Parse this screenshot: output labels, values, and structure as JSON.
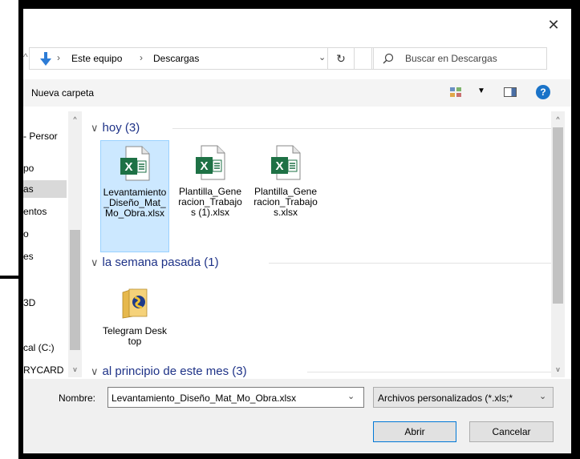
{
  "dialog": {
    "close_glyph": "✕",
    "nav_up_glyph": "^"
  },
  "address": {
    "sep1": "›",
    "crumb1": "Este equipo",
    "sep2": "›",
    "crumb2": "Descargas",
    "dropdown_glyph": "⌄",
    "refresh_glyph": "↻"
  },
  "search": {
    "placeholder": "Buscar en Descargas"
  },
  "commandbar": {
    "new_folder": "Nueva carpeta",
    "view_drop_glyph": "▼",
    "help_glyph": "?"
  },
  "nav_pane": {
    "items": [
      {
        "label": "- Persor"
      },
      {
        "label": "po"
      },
      {
        "label": "as"
      },
      {
        "label": "entos"
      },
      {
        "label": "o"
      },
      {
        "label": "es"
      },
      {
        "label": "3D"
      },
      {
        "label": "cal (C:)"
      },
      {
        "label": "RYCARD"
      }
    ],
    "scroll_up": "^",
    "scroll_down": "v"
  },
  "groups": [
    {
      "header": "hoy (3)",
      "chevron": "∨",
      "files": [
        {
          "name": "Levantamiento_Diseño_Mat_Mo_Obra.xlsx",
          "icon": "excel-icon"
        },
        {
          "name": "Plantilla_Generacion_Trabajos (1).xlsx",
          "icon": "excel-icon"
        },
        {
          "name": "Plantilla_Generacion_Trabajos.xlsx",
          "icon": "excel-icon"
        }
      ]
    },
    {
      "header": "la semana pasada (1)",
      "chevron": "∨",
      "files": [
        {
          "name": "Telegram Desktop",
          "icon": "folder-icon"
        }
      ]
    },
    {
      "header": "al principio de este mes (3)",
      "chevron": "∨",
      "files": []
    }
  ],
  "bottom": {
    "name_label": "Nombre:",
    "filename": "Levantamiento_Diseño_Mat_Mo_Obra.xlsx",
    "filetype": "Archivos personalizados (*.xls;*",
    "drop_glyph": "⌄",
    "open": "Abrir",
    "cancel": "Cancelar"
  },
  "colors": {
    "accent": "#0078d7",
    "group_header": "#1e3287",
    "selection": "#cce8ff",
    "excel_green": "#1e7145"
  }
}
